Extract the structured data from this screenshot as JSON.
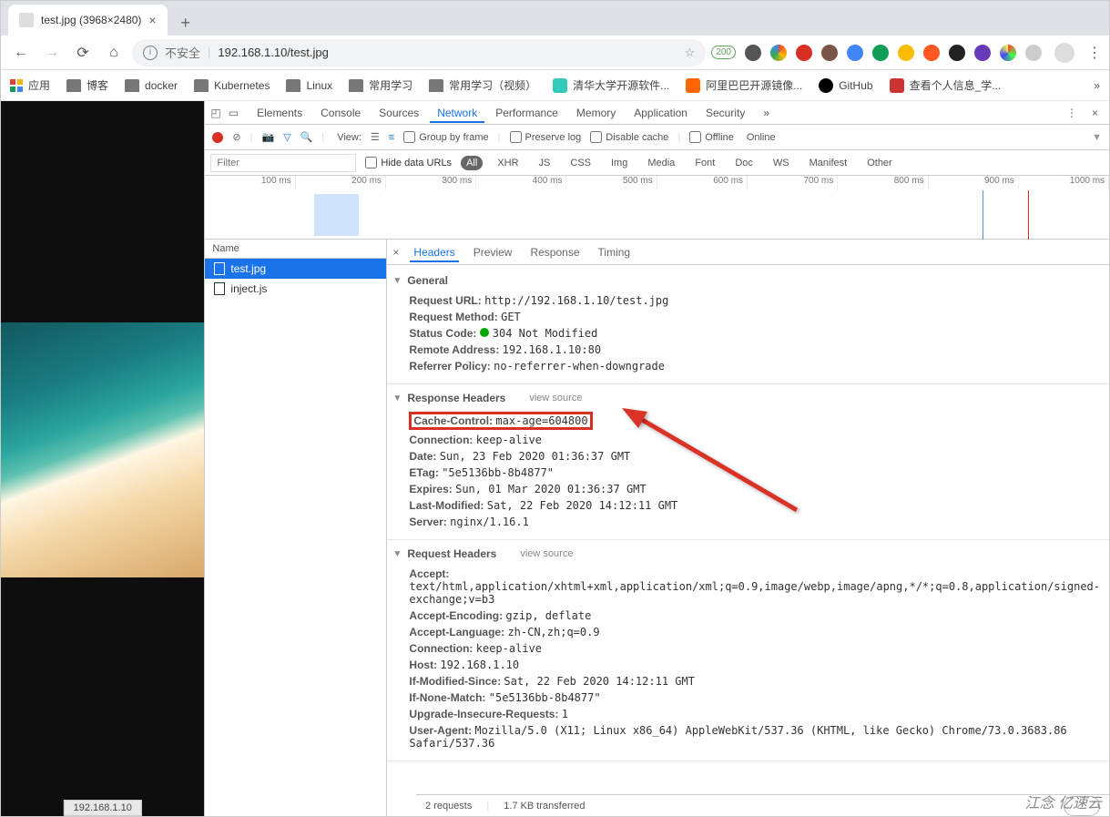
{
  "tab": {
    "title": "test.jpg (3968×2480)"
  },
  "addr": {
    "insecure": "不安全",
    "divider": "|",
    "url": "192.168.1.10/test.jpg",
    "badge": "200"
  },
  "bookmarks": {
    "apps": "应用",
    "items": [
      "博客",
      "docker",
      "Kubernetes",
      "Linux",
      "常用学习",
      "常用学习（视频）",
      "清华大学开源软件...",
      "阿里巴巴开源镜像...",
      "GitHub",
      "查看个人信息_学..."
    ]
  },
  "status": "192.168.1.10",
  "devtools": {
    "tabs": [
      "Elements",
      "Console",
      "Sources",
      "Network",
      "Performance",
      "Memory",
      "Application",
      "Security"
    ],
    "active_tab": "Network",
    "toolbar": {
      "view": "View:",
      "group": "Group by frame",
      "preserve": "Preserve log",
      "disable_cache": "Disable cache",
      "offline": "Offline",
      "online": "Online"
    },
    "filter": {
      "placeholder": "Filter",
      "value": "",
      "hide": "Hide data URLs",
      "types": [
        "All",
        "XHR",
        "JS",
        "CSS",
        "Img",
        "Media",
        "Font",
        "Doc",
        "WS",
        "Manifest",
        "Other"
      ],
      "active_type": "All"
    },
    "timeline_ticks": [
      "100 ms",
      "200 ms",
      "300 ms",
      "400 ms",
      "500 ms",
      "600 ms",
      "700 ms",
      "800 ms",
      "900 ms",
      "1000 ms"
    ],
    "names_header": "Name",
    "files": [
      {
        "name": "test.jpg",
        "selected": true
      },
      {
        "name": "inject.js",
        "selected": false
      }
    ],
    "detail_tabs": [
      "Headers",
      "Preview",
      "Response",
      "Timing"
    ],
    "active_detail": "Headers",
    "general": {
      "title": "General",
      "request_url_k": "Request URL:",
      "request_url": "http://192.168.1.10/test.jpg",
      "request_method_k": "Request Method:",
      "request_method": "GET",
      "status_code_k": "Status Code:",
      "status_code": "304 Not Modified",
      "remote_addr_k": "Remote Address:",
      "remote_addr": "192.168.1.10:80",
      "referrer_policy_k": "Referrer Policy:",
      "referrer_policy": "no-referrer-when-downgrade"
    },
    "resp": {
      "title": "Response Headers",
      "view_source": "view source",
      "cache_control_k": "Cache-Control:",
      "cache_control": "max-age=604800",
      "connection_k": "Connection:",
      "connection": "keep-alive",
      "date_k": "Date:",
      "date": "Sun, 23 Feb 2020 01:36:37 GMT",
      "etag_k": "ETag:",
      "etag": "\"5e5136bb-8b4877\"",
      "expires_k": "Expires:",
      "expires": "Sun, 01 Mar 2020 01:36:37 GMT",
      "last_modified_k": "Last-Modified:",
      "last_modified": "Sat, 22 Feb 2020 14:12:11 GMT",
      "server_k": "Server:",
      "server": "nginx/1.16.1"
    },
    "req": {
      "title": "Request Headers",
      "view_source": "view source",
      "accept_k": "Accept:",
      "accept": "text/html,application/xhtml+xml,application/xml;q=0.9,image/webp,image/apng,*/*;q=0.8,application/signed-exchange;v=b3",
      "accept_encoding_k": "Accept-Encoding:",
      "accept_encoding": "gzip, deflate",
      "accept_language_k": "Accept-Language:",
      "accept_language": "zh-CN,zh;q=0.9",
      "connection_k": "Connection:",
      "connection": "keep-alive",
      "host_k": "Host:",
      "host": "192.168.1.10",
      "if_modified_since_k": "If-Modified-Since:",
      "if_modified_since": "Sat, 22 Feb 2020 14:12:11 GMT",
      "if_none_match_k": "If-None-Match:",
      "if_none_match": "\"5e5136bb-8b4877\"",
      "upgrade_insecure_k": "Upgrade-Insecure-Requests:",
      "upgrade_insecure": "1",
      "user_agent_k": "User-Agent:",
      "user_agent": "Mozilla/5.0 (X11; Linux x86_64) AppleWebKit/537.36 (KHTML, like Gecko) Chrome/73.0.3683.86 Safari/537.36"
    },
    "footer": {
      "requests": "2 requests",
      "transferred": "1.7 KB transferred"
    }
  },
  "watermark": "江念 亿速云"
}
